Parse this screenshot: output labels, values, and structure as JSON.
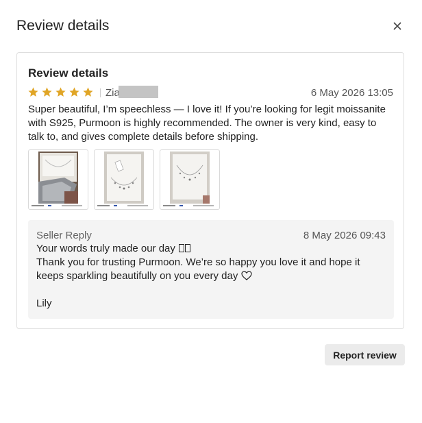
{
  "dialog": {
    "title": "Review details",
    "close_icon": "close-icon"
  },
  "review": {
    "title": "Review details",
    "rating": 5,
    "rating_max": 5,
    "star_color": "#e0a526",
    "reviewer_name_visible": "Zia",
    "date": "6 May 2026 13:05",
    "text": "Super beautiful, I’m speechless — I love it! If you’re looking for legit moissanite with S925, Purmoon is highly recommended. The owner is very kind, easy to talk to, and gives complete details before shipping.",
    "photos": [
      {
        "name": "review-photo-1"
      },
      {
        "name": "review-photo-2"
      },
      {
        "name": "review-photo-3"
      }
    ]
  },
  "seller_reply": {
    "label": "Seller Reply",
    "date": "8 May 2026 09:43",
    "line1": "Your words truly made our day",
    "line2": "Thank you for trusting Purmoon. We’re so happy you love it and hope it keeps sparkling beautifully on you every day",
    "signature": "Lily"
  },
  "actions": {
    "report_label": "Report review"
  }
}
